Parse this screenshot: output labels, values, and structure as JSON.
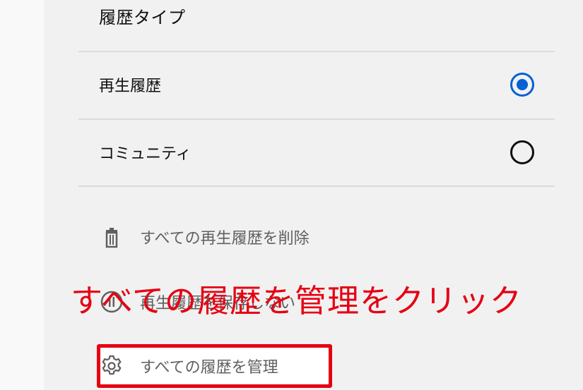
{
  "history_type": {
    "title": "履歴タイプ",
    "options": [
      {
        "label": "再生履歴",
        "selected": true
      },
      {
        "label": "コミュニティ",
        "selected": false
      }
    ]
  },
  "actions": {
    "clear_watch_history": {
      "label": "すべての再生履歴を削除",
      "icon": "trash-icon"
    },
    "pause_watch_history": {
      "label": "再生履歴を保存しない",
      "icon": "pause-circle-icon"
    },
    "manage_all_history": {
      "label": "すべての履歴を管理",
      "icon": "gear-icon"
    }
  },
  "annotation": {
    "text": "すべての履歴を管理をクリック",
    "color": "#e60012"
  },
  "colors": {
    "radio_selected": "#065fd4",
    "panel_background": "#f1f1f1"
  }
}
